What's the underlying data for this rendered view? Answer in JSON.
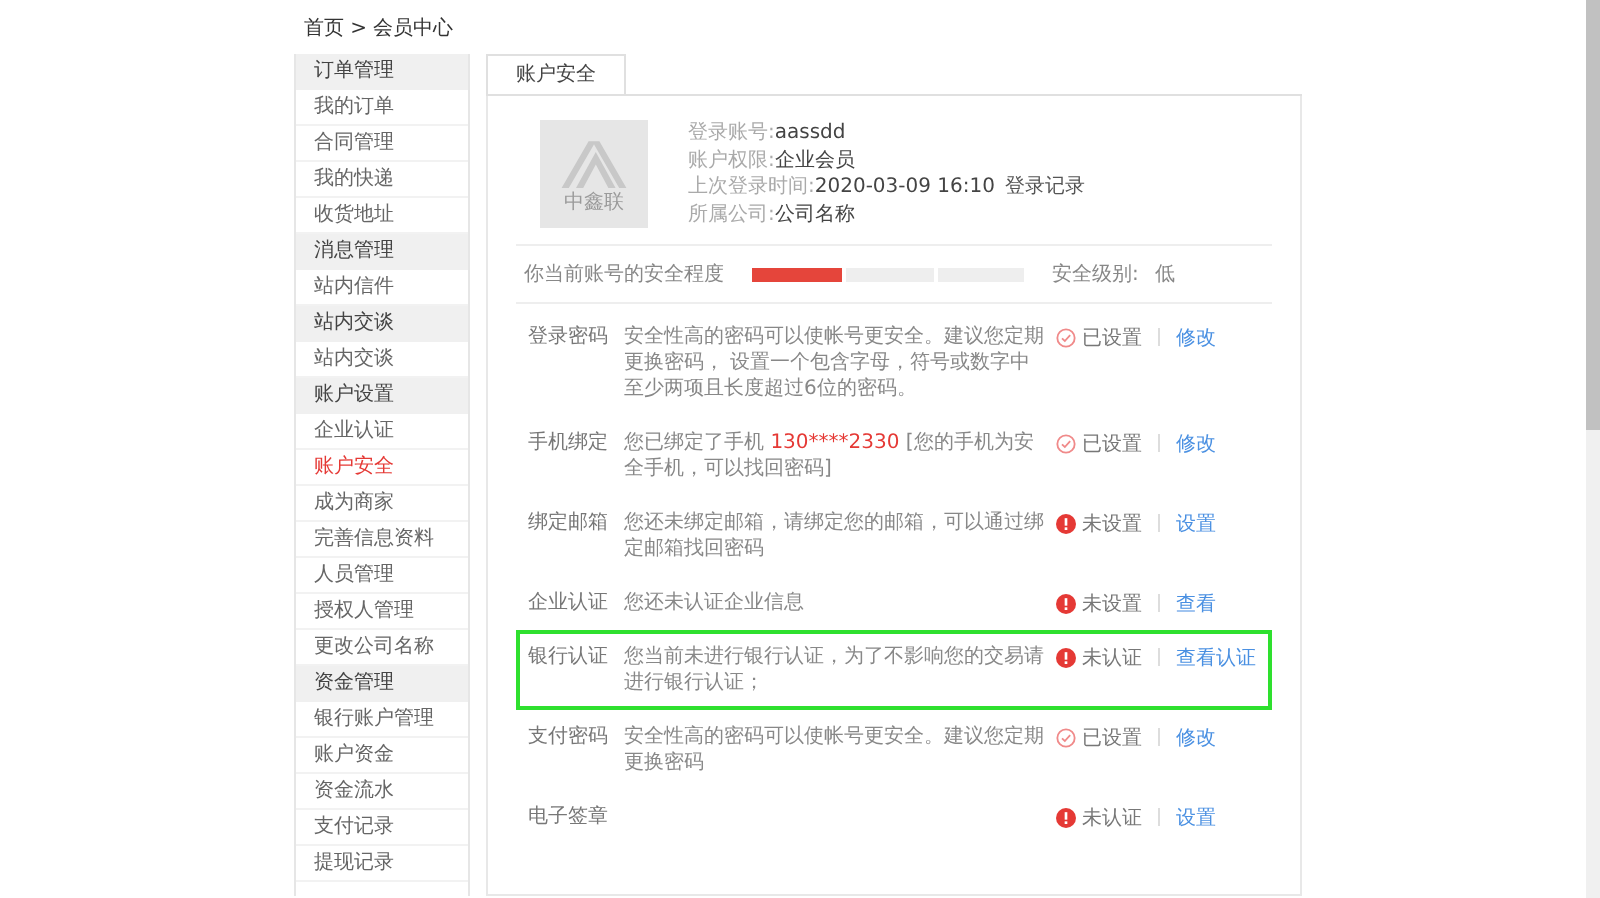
{
  "breadcrumb": "首页 > 会员中心",
  "sidebar": [
    {
      "kind": "group",
      "label": "订单管理",
      "selected": false
    },
    {
      "kind": "item",
      "label": "我的订单",
      "selected": false
    },
    {
      "kind": "item",
      "label": "合同管理",
      "selected": false
    },
    {
      "kind": "item",
      "label": "我的快递",
      "selected": false
    },
    {
      "kind": "item",
      "label": "收货地址",
      "selected": false
    },
    {
      "kind": "group",
      "label": "消息管理",
      "selected": false
    },
    {
      "kind": "item",
      "label": "站内信件",
      "selected": false
    },
    {
      "kind": "group",
      "label": "站内交谈",
      "selected": false
    },
    {
      "kind": "item",
      "label": "站内交谈",
      "selected": false
    },
    {
      "kind": "group",
      "label": "账户设置",
      "selected": false
    },
    {
      "kind": "item",
      "label": "企业认证",
      "selected": false
    },
    {
      "kind": "item",
      "label": "账户安全",
      "selected": true
    },
    {
      "kind": "item",
      "label": "成为商家",
      "selected": false
    },
    {
      "kind": "item",
      "label": "完善信息资料",
      "selected": false
    },
    {
      "kind": "item",
      "label": "人员管理",
      "selected": false
    },
    {
      "kind": "item",
      "label": "授权人管理",
      "selected": false
    },
    {
      "kind": "item",
      "label": "更改公司名称",
      "selected": false
    },
    {
      "kind": "group",
      "label": "资金管理",
      "selected": false
    },
    {
      "kind": "item",
      "label": "银行账户管理",
      "selected": false
    },
    {
      "kind": "item",
      "label": "账户资金",
      "selected": false
    },
    {
      "kind": "item",
      "label": "资金流水",
      "selected": false
    },
    {
      "kind": "item",
      "label": "支付记录",
      "selected": false
    },
    {
      "kind": "item",
      "label": "提现记录",
      "selected": false
    }
  ],
  "tabs": [
    {
      "label": "账户安全",
      "selected": true
    }
  ],
  "profile": {
    "logo_text": "中鑫联",
    "fields": [
      {
        "label": "登录账号:",
        "value": "aassdd"
      },
      {
        "label": "账户权限:",
        "value": "企业会员"
      },
      {
        "label": "上次登录时间:",
        "value": "2020-03-09 16:10",
        "link": "登录记录"
      },
      {
        "label": "所属公司:",
        "value": "公司名称"
      }
    ]
  },
  "security": {
    "label": "你当前账号的安全程度",
    "level": 0.333,
    "level_label": "安全级别:",
    "level_value": "低"
  },
  "items": [
    {
      "name": "登录密码",
      "description": [
        {
          "text": "安全性高的密码可以使帐号更安全。建议您定期更换密码， 设置一个包含字母，符号或数字中至少两项且长度超过6位的密码。",
          "accent": false
        }
      ],
      "status": "已设置",
      "done": true,
      "action": "修改",
      "highlighted": false
    },
    {
      "name": "手机绑定",
      "description": [
        {
          "text": "您已绑定了手机 ",
          "accent": false
        },
        {
          "text": "130****2330",
          "accent": true
        },
        {
          "text": " [您的手机为安全手机，可以找回密码]",
          "accent": false
        }
      ],
      "status": "已设置",
      "done": true,
      "action": "修改",
      "highlighted": false
    },
    {
      "name": "绑定邮箱",
      "description": [
        {
          "text": "您还未绑定邮箱，请绑定您的邮箱，可以通过绑定邮箱找回密码",
          "accent": false
        }
      ],
      "status": "未设置",
      "done": false,
      "action": "设置",
      "highlighted": false
    },
    {
      "name": "企业认证",
      "description": [
        {
          "text": "您还未认证企业信息",
          "accent": false
        }
      ],
      "status": "未设置",
      "done": false,
      "action": "查看",
      "highlighted": false
    },
    {
      "name": "银行认证",
      "description": [
        {
          "text": "您当前未进行银行认证，为了不影响您的交易请进行银行认证；",
          "accent": false
        }
      ],
      "status": "未认证",
      "done": false,
      "action": "查看认证",
      "highlighted": true
    },
    {
      "name": "支付密码",
      "description": [
        {
          "text": "安全性高的密码可以使帐号更安全。建议您定期更换密码",
          "accent": false
        }
      ],
      "status": "已设置",
      "done": true,
      "action": "修改",
      "highlighted": false
    },
    {
      "name": "电子签章",
      "status": "未认证",
      "done": false,
      "action": "设置",
      "highlighted": false
    }
  ]
}
